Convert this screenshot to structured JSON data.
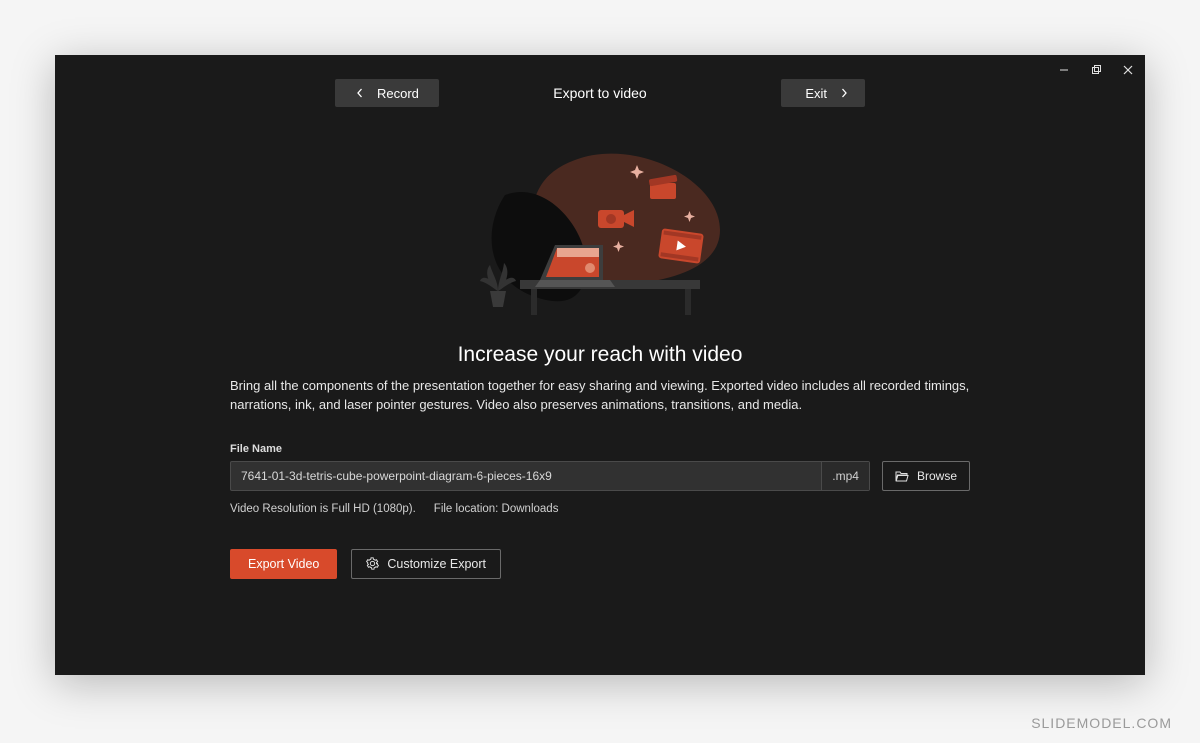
{
  "window": {
    "minimize_title": "Minimize",
    "maximize_title": "Restore",
    "close_title": "Close"
  },
  "topbar": {
    "record_label": "Record",
    "page_title": "Export to video",
    "exit_label": "Exit"
  },
  "hero": {
    "title": "Increase your reach with video",
    "subtitle": "Bring all the components of the presentation together for easy sharing and viewing. Exported video includes all recorded timings, narrations, ink, and laser pointer gestures. Video also preserves animations, transitions, and media."
  },
  "file": {
    "label": "File Name",
    "value": "7641-01-3d-tetris-cube-powerpoint-diagram-6-pieces-16x9",
    "extension": ".mp4",
    "browse_label": "Browse"
  },
  "meta": {
    "resolution": "Video Resolution is Full HD (1080p).",
    "location": "File location: Downloads"
  },
  "actions": {
    "export_label": "Export Video",
    "customize_label": "Customize Export"
  },
  "watermark": "SLIDEMODEL.COM"
}
